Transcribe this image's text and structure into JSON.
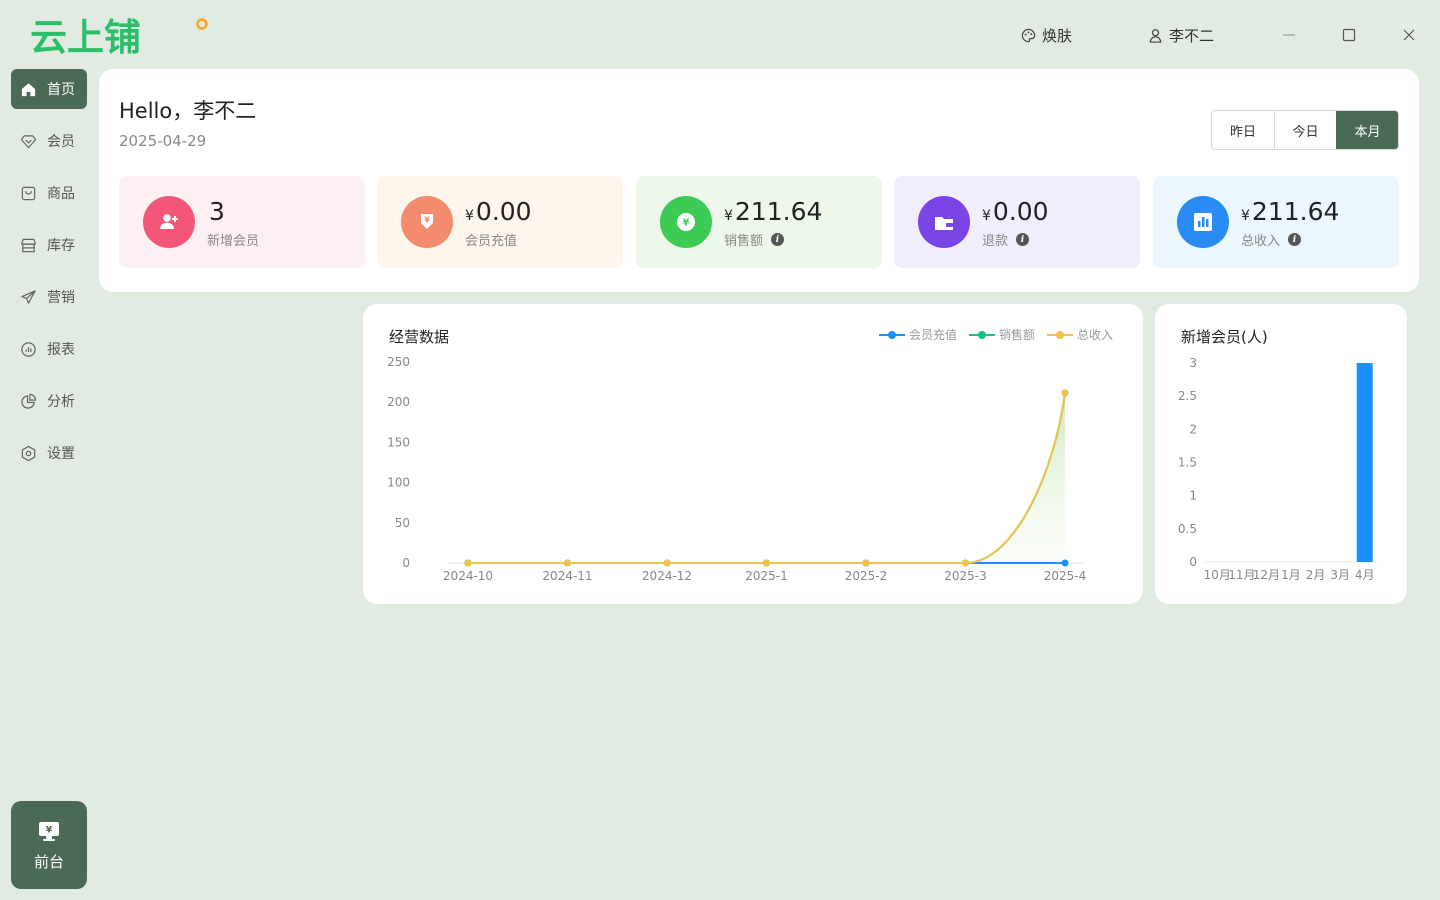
{
  "app": {
    "logo_text": "云上铺"
  },
  "topbar": {
    "skin_label": "焕肤",
    "user_name": "李不二"
  },
  "sidebar": {
    "items": [
      {
        "label": "首页",
        "icon": "home-icon",
        "active": true
      },
      {
        "label": "会员",
        "icon": "diamond-icon",
        "active": false
      },
      {
        "label": "商品",
        "icon": "bag-icon",
        "active": false
      },
      {
        "label": "库存",
        "icon": "store-icon",
        "active": false
      },
      {
        "label": "营销",
        "icon": "send-icon",
        "active": false
      },
      {
        "label": "报表",
        "icon": "report-icon",
        "active": false
      },
      {
        "label": "分析",
        "icon": "pie-icon",
        "active": false
      },
      {
        "label": "设置",
        "icon": "settings-icon",
        "active": false
      }
    ],
    "frontdesk_label": "前台"
  },
  "welcome": {
    "greeting": "Hello，李不二",
    "date": "2025-04-29",
    "periods": [
      "昨日",
      "今日",
      "本月"
    ],
    "active_period": "本月"
  },
  "stats": [
    {
      "value": "3",
      "currency": "",
      "label": "新增会员",
      "info": false,
      "bg": "#fdf0f2",
      "color": "#f2577a",
      "icon": "user-add-icon"
    },
    {
      "value": "0.00",
      "currency": "¥",
      "label": "会员充值",
      "info": false,
      "bg": "#fef6ec",
      "color": "#f48a6e",
      "icon": "recharge-icon"
    },
    {
      "value": "211.64",
      "currency": "¥",
      "label": "销售额",
      "info": true,
      "bg": "#eef8ea",
      "color": "#3ccc55",
      "icon": "coin-icon"
    },
    {
      "value": "0.00",
      "currency": "¥",
      "label": "退款",
      "info": true,
      "bg": "#f0eefc",
      "color": "#7a44e6",
      "icon": "wallet-icon"
    },
    {
      "value": "211.64",
      "currency": "¥",
      "label": "总收入",
      "info": true,
      "bg": "#ecf6fd",
      "color": "#2a8cf2",
      "icon": "bar-chart-icon"
    }
  ],
  "chart_data": [
    {
      "type": "line",
      "title": "经营数据",
      "x": [
        "2024-10",
        "2024-11",
        "2024-12",
        "2025-1",
        "2025-2",
        "2025-3",
        "2025-4"
      ],
      "ylim": [
        0,
        250
      ],
      "yticks": [
        0,
        50,
        100,
        150,
        200,
        250
      ],
      "grid": false,
      "legend": "top-right",
      "series": [
        {
          "name": "会员充值",
          "color": "#1890ff",
          "values": [
            0,
            0,
            0,
            0,
            0,
            0,
            0
          ]
        },
        {
          "name": "销售额",
          "color": "#13c28d",
          "values": [
            0,
            0,
            0,
            0,
            0,
            0,
            211.64
          ]
        },
        {
          "name": "总收入",
          "color": "#f2c346",
          "values": [
            0,
            0,
            0,
            0,
            0,
            0,
            211.64
          ]
        }
      ]
    },
    {
      "type": "bar",
      "title": "新增会员(人)",
      "categories": [
        "10月",
        "11月",
        "12月",
        "1月",
        "2月",
        "3月",
        "4月"
      ],
      "values": [
        0,
        0,
        0,
        0,
        0,
        0,
        3
      ],
      "ylim": [
        0,
        3
      ],
      "yticks": [
        0,
        0.5,
        1,
        1.5,
        2,
        2.5,
        3
      ],
      "color": "#1890ff",
      "grid": false
    }
  ]
}
